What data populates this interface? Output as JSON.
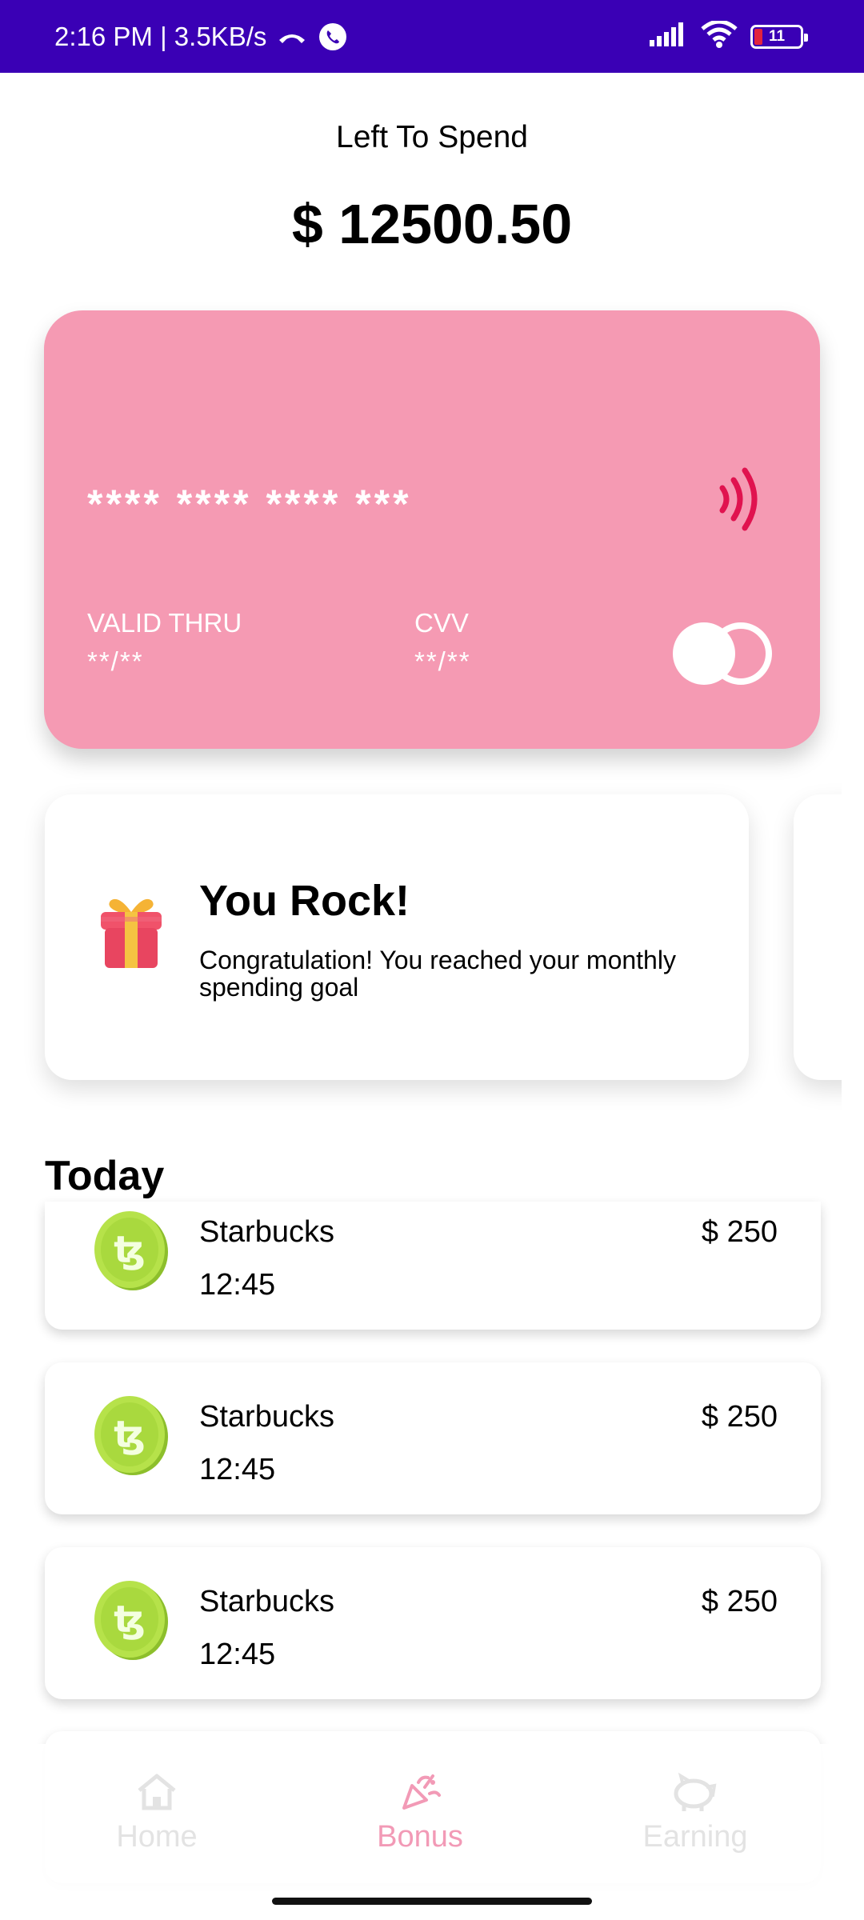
{
  "status_bar": {
    "time_speed": "2:16 PM | 3.5KB/s",
    "battery_level": "11",
    "background_color": "#3a00b5",
    "icons": [
      "missed-call-icon",
      "whatsapp-icon",
      "signal-icon",
      "wifi-icon",
      "battery-icon"
    ]
  },
  "summary": {
    "label": "Left To Spend",
    "balance": "$ 12500.50"
  },
  "card": {
    "number": "**** **** **** ***",
    "valid_label": "VALID THRU",
    "valid_value": "**/**",
    "cvv_label": "CVV",
    "cvv_value": "**/**",
    "color": "#f59ab3",
    "icons": [
      "contactless-icon",
      "card-brand-icon"
    ]
  },
  "bonus": {
    "title": "You Rock!",
    "description": "Congratulation! You reached your monthly spending goal",
    "icon": "gift-icon"
  },
  "transactions": {
    "heading": "Today",
    "items": [
      {
        "name": "Starbucks",
        "time": "12:45",
        "amount": "$ 250",
        "icon": "coin-icon"
      },
      {
        "name": "Starbucks",
        "time": "12:45",
        "amount": "$ 250",
        "icon": "coin-icon"
      },
      {
        "name": "Starbucks",
        "time": "12:45",
        "amount": "$ 250",
        "icon": "coin-icon"
      },
      {
        "name": "",
        "time": "",
        "amount": "",
        "icon": ""
      }
    ]
  },
  "bottom_nav": {
    "items": [
      {
        "label": "Home",
        "icon": "home-icon",
        "active": false
      },
      {
        "label": "Bonus",
        "icon": "party-popper-icon",
        "active": true
      },
      {
        "label": "Earning",
        "icon": "piggy-bank-icon",
        "active": false
      }
    ],
    "active_color": "#f29ab6",
    "inactive_color": "#e3e3e3"
  }
}
